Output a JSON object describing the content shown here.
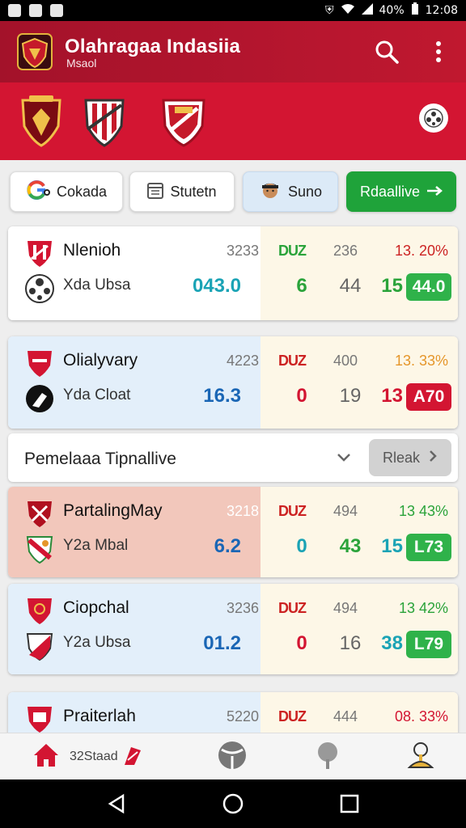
{
  "status": {
    "battery": "40%",
    "time": "12:08"
  },
  "app": {
    "title": "Olahragaa Indasiia",
    "subtitle": "Msaol"
  },
  "filters": {
    "f1": "Cokada",
    "f2": "Stutetn",
    "f3": "Suno",
    "f4": "Rdaallive"
  },
  "cards": [
    {
      "top": {
        "name": "Nlenioh",
        "num": "3233",
        "tag": "DUZ",
        "mid": "236",
        "pct": "13. 20%"
      },
      "bottom": {
        "name": "Xda Ubsa",
        "score": "043.0",
        "g1": "6",
        "g2": "44",
        "g3": "15",
        "pill": "44.0"
      }
    },
    {
      "top": {
        "name": "Olialyvary",
        "num": "4223",
        "tag": "DUZ",
        "mid": "400",
        "pct": "13. 33%"
      },
      "bottom": {
        "name": "Yda Cloat",
        "score": "16.3",
        "g1": "0",
        "g2": "19",
        "g3": "13",
        "pill": "A70"
      }
    },
    {
      "top": {
        "name": "PartalingMay",
        "num": "3218",
        "tag": "DUZ",
        "mid": "494",
        "pct": "13 43%"
      },
      "bottom": {
        "name": "Y2a Mbal",
        "score": "6.2",
        "g1": "0",
        "g2": "43",
        "g3": "15",
        "pill": "L73"
      }
    },
    {
      "top": {
        "name": "Ciopchal",
        "num": "3236",
        "tag": "DUZ",
        "mid": "494",
        "pct": "13 42%"
      },
      "bottom": {
        "name": "Y2a Ubsa",
        "score": "01.2",
        "g1": "0",
        "g2": "16",
        "g3": "38",
        "pill": "L79"
      }
    },
    {
      "top": {
        "name": "Praiterlah",
        "num": "5220",
        "tag": "DUZ",
        "mid": "444",
        "pct": "08. 33%"
      }
    }
  ],
  "banner": {
    "title": "Pemelaaa Tipnallive",
    "button": "Rleak"
  },
  "bottomnav": {
    "item1": "32Staad"
  },
  "colors": {
    "brand": "#c0182f",
    "green": "#1fa33a",
    "red": "#d31532",
    "teal": "#1aa3b5"
  }
}
